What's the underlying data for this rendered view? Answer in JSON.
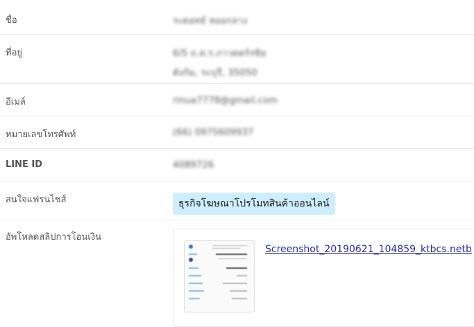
{
  "fields": {
    "name": {
      "label": "ชื่อ",
      "value": "ระดอทธ์ หออกลาง"
    },
    "address": {
      "label": "ที่อยู่",
      "line1": "6/5 ถ.ส.ร.ภาวดตร์รขิย",
      "line2": "ดังก้ม, ระบุรี, 35050"
    },
    "email": {
      "label": "อีเมล์",
      "value": "rinua7778@gmail.com"
    },
    "phone": {
      "label": "หมายเลขโทรศัพท์",
      "value": "(66) 0975609937"
    },
    "line_id": {
      "label": "LINE ID",
      "value": "4089726"
    },
    "franchise": {
      "label": "สนใจแฟรนไชส์",
      "value": "ธุรกิจโฆษณาโปรโมทสินค้าออนไลน์"
    },
    "upload": {
      "label": "อัพโหลดสลิปการโอนเงิน",
      "file_name": "Screenshot_20190621_104859_ktbcs.netb"
    }
  },
  "colors": {
    "badge_bg": "#cfeefd",
    "link": "#2a2aa8"
  }
}
